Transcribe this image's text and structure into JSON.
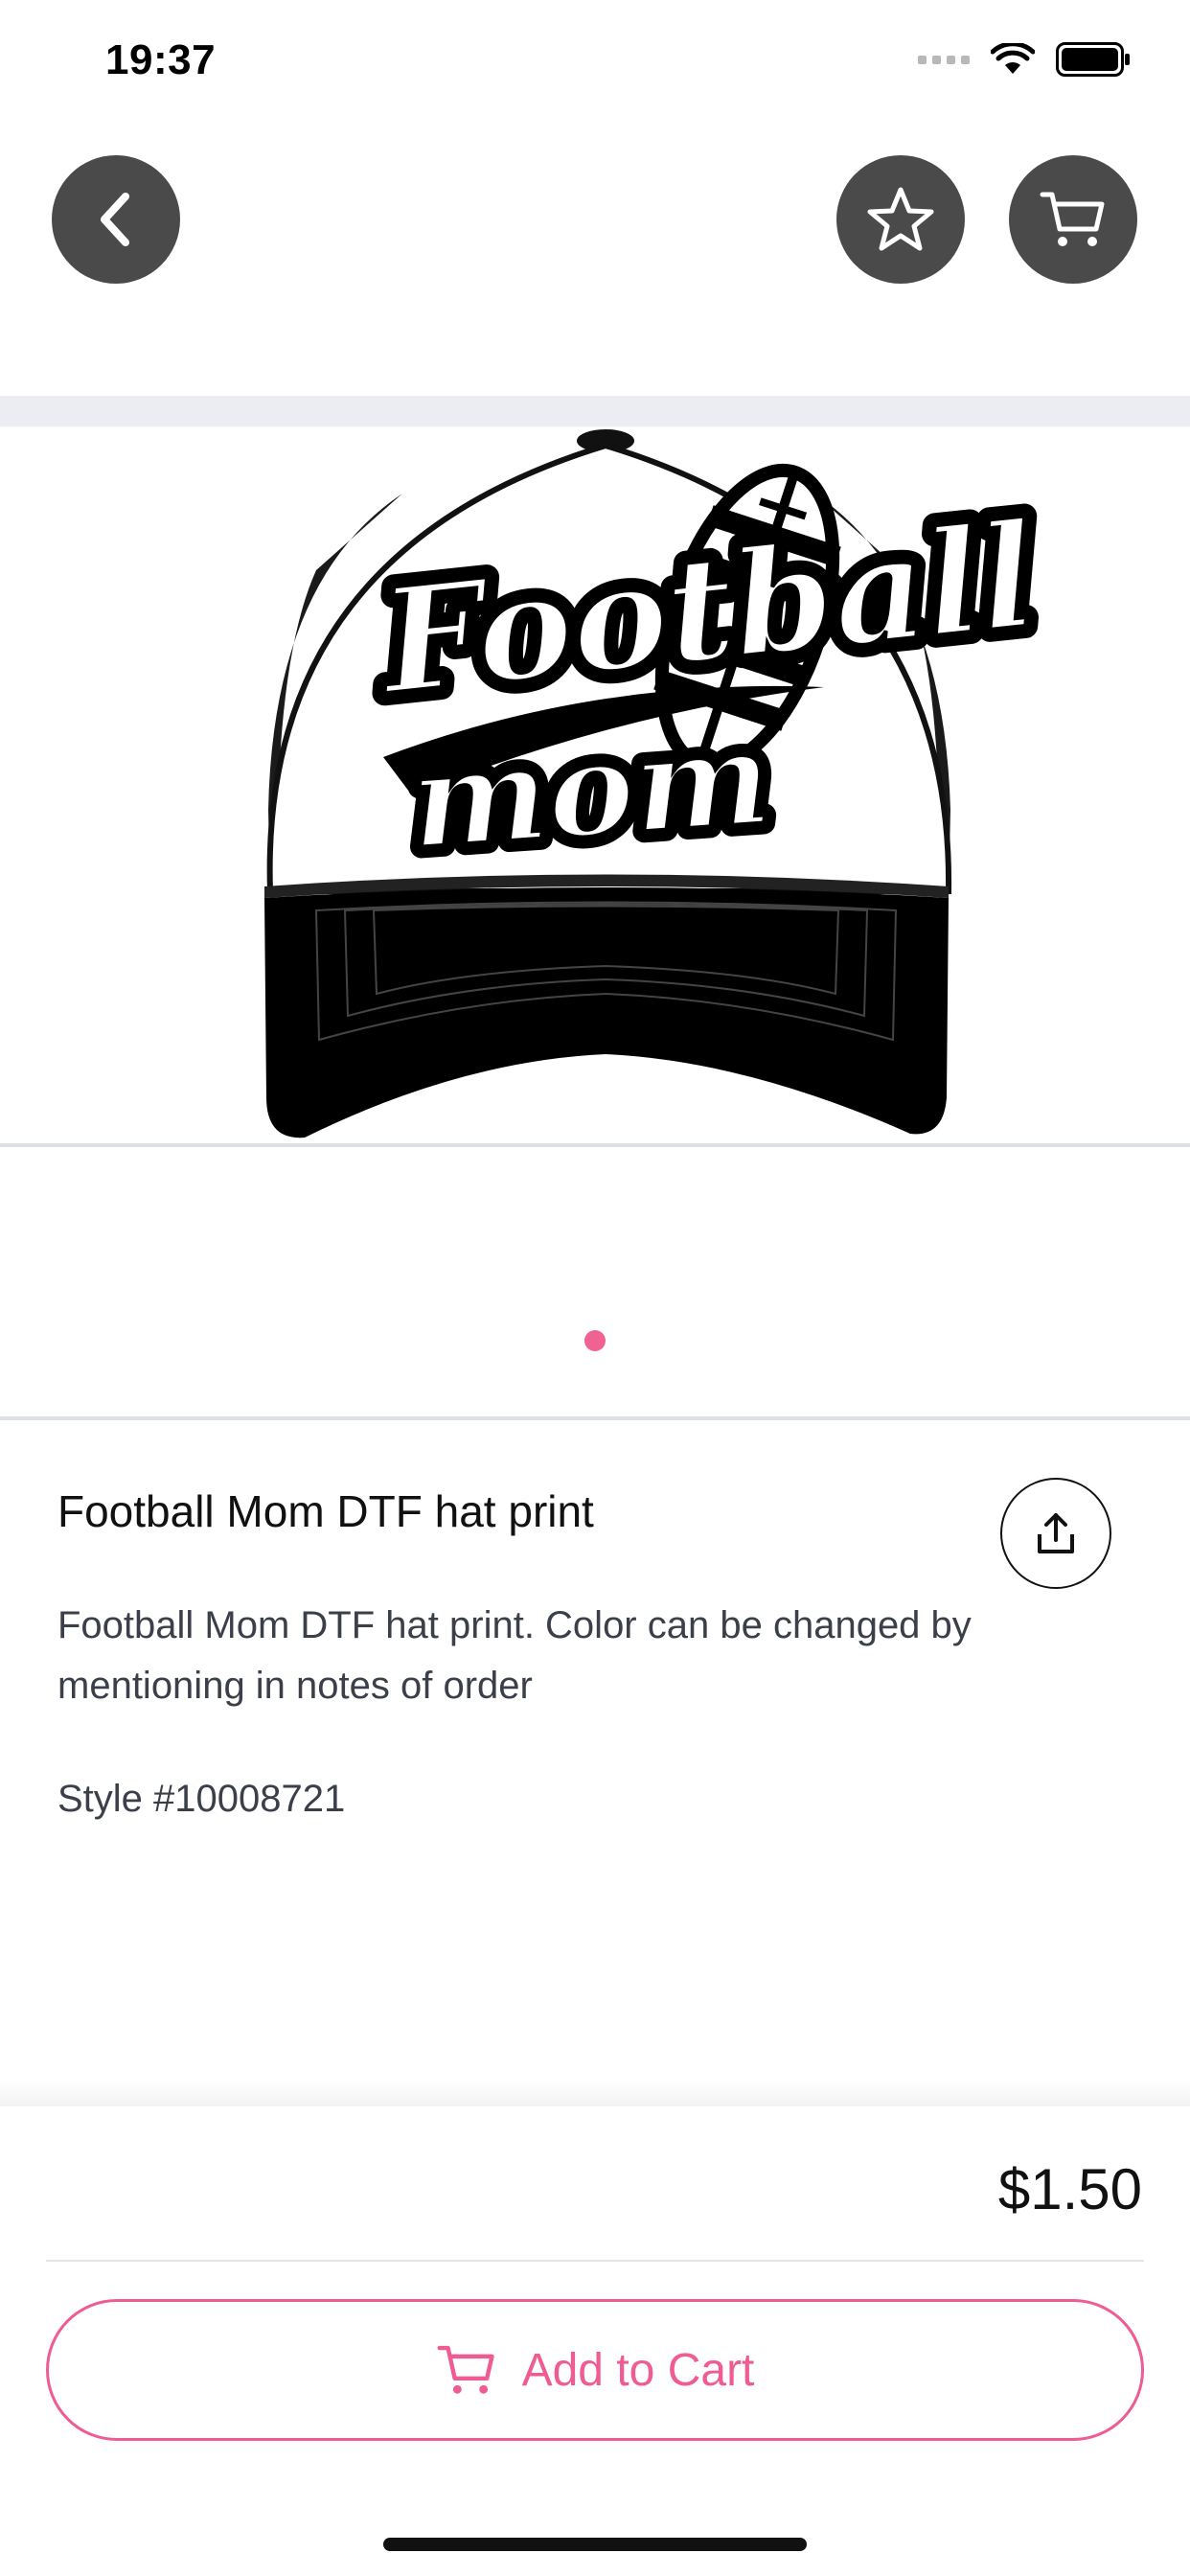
{
  "status_bar": {
    "time": "19:37"
  },
  "icons": {
    "back": "chevron-left-icon",
    "favorite": "star-icon",
    "cart": "cart-icon",
    "share": "share-icon"
  },
  "product": {
    "title": "Football Mom DTF hat print",
    "description": "Football Mom DTF hat print. Color can be changed by mentioning in notes of order",
    "style": "Style #10008721",
    "image_text_line1": "Football",
    "image_text_line2": "mom",
    "carousel": {
      "current": 1,
      "total": 1
    }
  },
  "purchase": {
    "price": "$1.50",
    "add_to_cart_label": "Add to Cart"
  },
  "colors": {
    "accent": "#ef5b93",
    "nav_button": "#4a4a4a",
    "dot": "#f06292"
  }
}
